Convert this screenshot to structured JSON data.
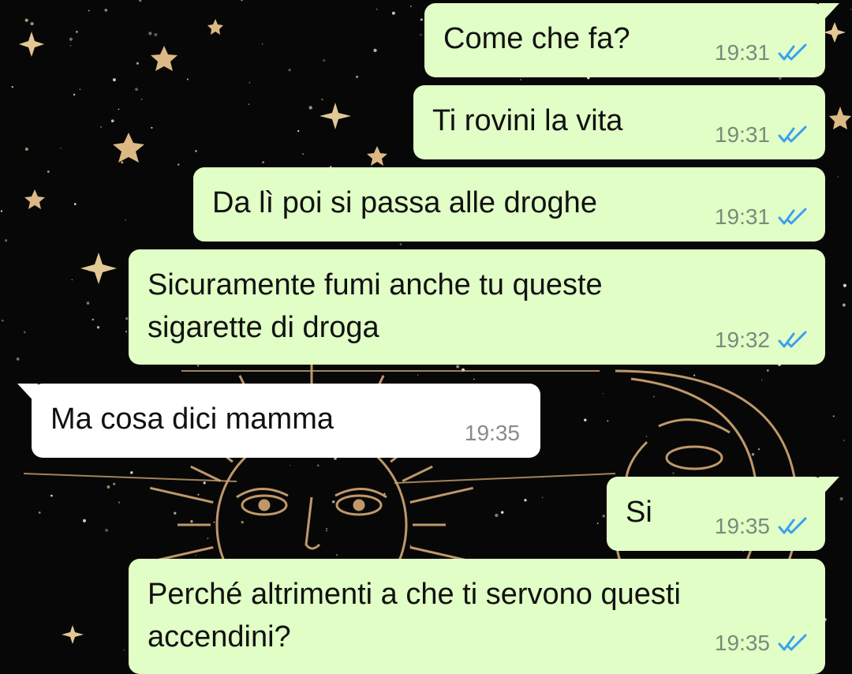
{
  "colors": {
    "outgoing_bubble": "#e1fec6",
    "incoming_bubble": "#ffffff",
    "read_ticks": "#3aa0ef",
    "background": "#070707",
    "ornament_gold": "#d8b582"
  },
  "messages": [
    {
      "direction": "outgoing",
      "text": "Come che fa?",
      "time": "19:31",
      "status_icon": "read-double-check-icon"
    },
    {
      "direction": "outgoing",
      "text": "Ti rovini la vita",
      "time": "19:31",
      "status_icon": "read-double-check-icon"
    },
    {
      "direction": "outgoing",
      "text": "Da lì poi si passa alle droghe",
      "time": "19:31",
      "status_icon": "read-double-check-icon"
    },
    {
      "direction": "outgoing",
      "lines": [
        "Sicuramente fumi anche tu queste",
        "sigarette di droga"
      ],
      "time": "19:32",
      "status_icon": "read-double-check-icon"
    },
    {
      "direction": "incoming",
      "text": "Ma cosa dici mamma",
      "time": "19:35"
    },
    {
      "direction": "outgoing",
      "text": "Si",
      "time": "19:35",
      "status_icon": "read-double-check-icon"
    },
    {
      "direction": "outgoing",
      "lines": [
        "Perché altrimenti a che ti servono questi",
        "accendini?"
      ],
      "time": "19:35",
      "status_icon": "read-double-check-icon"
    }
  ]
}
